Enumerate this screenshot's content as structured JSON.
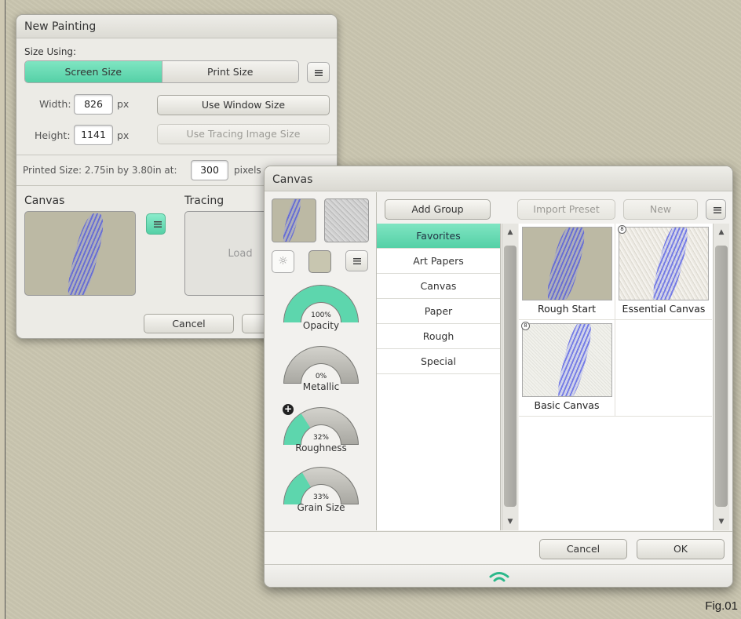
{
  "new_painting": {
    "title": "New Painting",
    "size_using_label": "Size Using:",
    "tabs": [
      "Screen Size",
      "Print Size"
    ],
    "width_label": "Width:",
    "width_value": "826",
    "height_label": "Height:",
    "height_value": "1141",
    "unit": "px",
    "use_window_size": "Use Window Size",
    "use_tracing_size": "Use Tracing Image Size",
    "printed_size_label": "Printed Size: 2.75in by 3.80in at:",
    "dpi_value": "300",
    "dpi_unit": "pixels",
    "canvas_label": "Canvas",
    "tracing_label": "Tracing",
    "load_label": "Load",
    "cancel": "Cancel"
  },
  "canvas_dialog": {
    "title": "Canvas",
    "add_group": "Add Group",
    "import_preset": "Import Preset",
    "new": "New",
    "groups": [
      "Favorites",
      "Art Papers",
      "Canvas",
      "Paper",
      "Rough",
      "Special"
    ],
    "selected_group": "Favorites",
    "presets": [
      {
        "name": "Rough Start",
        "badge": ""
      },
      {
        "name": "Essential Canvas",
        "badge": "8"
      },
      {
        "name": "Basic Canvas",
        "badge": "8"
      }
    ],
    "gauges": [
      {
        "name": "Opacity",
        "value": "100%",
        "fraction": 1.0
      },
      {
        "name": "Metallic",
        "value": "0%",
        "fraction": 0.0
      },
      {
        "name": "Roughness",
        "value": "32%",
        "fraction": 0.32
      },
      {
        "name": "Grain Size",
        "value": "33%",
        "fraction": 0.33
      }
    ],
    "cancel": "Cancel",
    "ok": "OK"
  },
  "figure_label": "Fig.01",
  "colors": {
    "accent": "#5dd6ad",
    "background": "#c9c5af"
  }
}
